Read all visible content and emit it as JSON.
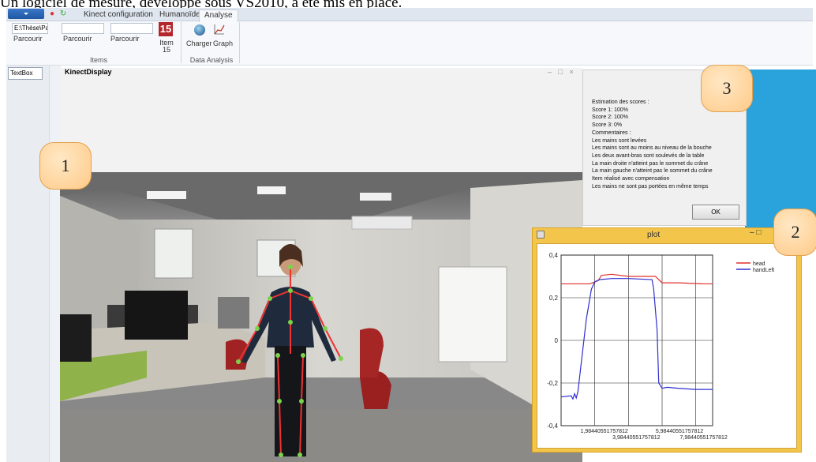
{
  "caption": "Un logiciel de mesure, développé sous VS2010, a été mis en place.",
  "ribbon": {
    "tabs": [
      "Kinect configuration",
      "Humanoïde",
      "Analyse"
    ],
    "items_group": {
      "path_value": "E:\\Thèse\\Patien",
      "browse_labels": [
        "Parcourir",
        "Parcourir",
        "Parcourir"
      ],
      "group_label": "Items"
    },
    "item_badge": {
      "number": "15",
      "label": "Item 15"
    },
    "data_analysis": {
      "buttons": [
        "Charger",
        "Graph"
      ],
      "group_label": "Data Analysis"
    }
  },
  "left_panel": {
    "textbox": "TextBox"
  },
  "kinect": {
    "title": "KinectDisplay",
    "controls": "– □ ×"
  },
  "score_dialog": {
    "lines": [
      "Estimation des scores :",
      "Score 1: 100%",
      "Score 2: 100%",
      "Score 3: 0%",
      "Commentaires :",
      "Les mains sont levées",
      "Les mains sont au moins au niveau de la bouche",
      "Les deux avant-bras sont soulevés de la table",
      "La main droite n'atteint pas le sommet du crâne",
      "La main gauche n'atteint pas le sommet du crâne",
      "Item réalisé avec compensation",
      "Les mains ne sont pas portées en même temps"
    ],
    "ok_label": "OK"
  },
  "plot_window": {
    "title": "plot",
    "controls": "– □"
  },
  "callouts": [
    "1",
    "2",
    "3"
  ],
  "chart_data": {
    "type": "line",
    "ylim": [
      -0.4,
      0.4
    ],
    "y_ticks": [
      "0,4",
      "0,2",
      "0",
      "-0,2",
      "-0,4"
    ],
    "x_ticks_upper": [
      "1,98440551757812",
      "5,98440551757812"
    ],
    "x_ticks_lower": [
      "3,98440551757812",
      "7,98440551757812"
    ],
    "xlim": [
      0,
      9
    ],
    "grid": true,
    "legend_position": "top-right",
    "series": [
      {
        "name": "head",
        "color": "#e0312f",
        "x": [
          0,
          1.7,
          2.2,
          2.4,
          3.0,
          4.0,
          5.6,
          6.0,
          7.0,
          8.5,
          9.0
        ],
        "y": [
          0.265,
          0.265,
          0.28,
          0.305,
          0.31,
          0.3,
          0.3,
          0.27,
          0.27,
          0.265,
          0.265
        ]
      },
      {
        "name": "handLeft",
        "color": "#2f2fd1",
        "x": [
          0,
          0.6,
          0.7,
          0.8,
          0.9,
          1.0,
          1.5,
          1.8,
          2.0,
          2.3,
          3.0,
          4.0,
          5.4,
          5.5,
          5.7,
          5.8,
          6.0,
          6.3,
          7.0,
          8.0,
          9.0
        ],
        "y": [
          -0.265,
          -0.26,
          -0.275,
          -0.25,
          -0.27,
          -0.24,
          0.1,
          0.24,
          0.275,
          0.285,
          0.29,
          0.29,
          0.285,
          0.24,
          0.05,
          -0.2,
          -0.225,
          -0.22,
          -0.225,
          -0.23,
          -0.23
        ]
      }
    ]
  }
}
